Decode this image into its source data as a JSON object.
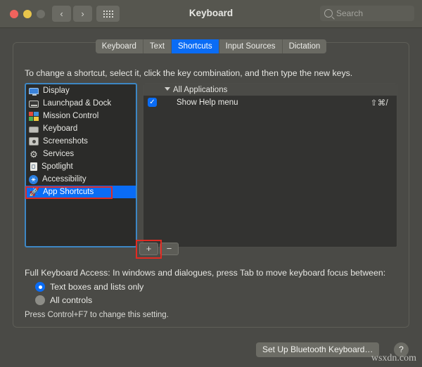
{
  "window": {
    "title": "Keyboard",
    "traffic_lights": [
      "close",
      "minimize",
      "zoom"
    ],
    "nav_back_icon": "chevron-left-icon",
    "nav_forward_icon": "chevron-right-icon",
    "apps_grid_icon": "grid-icon",
    "back_glyph": "‹",
    "forward_glyph": "›"
  },
  "search": {
    "placeholder": "Search",
    "value": "",
    "icon": "search-icon"
  },
  "tabs": [
    {
      "label": "Keyboard",
      "active": false
    },
    {
      "label": "Text",
      "active": false
    },
    {
      "label": "Shortcuts",
      "active": true
    },
    {
      "label": "Input Sources",
      "active": false
    },
    {
      "label": "Dictation",
      "active": false
    }
  ],
  "instructions": "To change a shortcut, select it, click the key combination, and then type the new keys.",
  "categories": [
    {
      "label": "Display",
      "icon": "display-icon",
      "selected": false
    },
    {
      "label": "Launchpad & Dock",
      "icon": "launchpad-icon",
      "selected": false
    },
    {
      "label": "Mission Control",
      "icon": "mission-control-icon",
      "selected": false
    },
    {
      "label": "Keyboard",
      "icon": "keyboard-icon",
      "selected": false
    },
    {
      "label": "Screenshots",
      "icon": "screenshots-icon",
      "selected": false
    },
    {
      "label": "Services",
      "icon": "services-gear-icon",
      "selected": false
    },
    {
      "label": "Spotlight",
      "icon": "spotlight-icon",
      "selected": false
    },
    {
      "label": "Accessibility",
      "icon": "accessibility-icon",
      "selected": false
    },
    {
      "label": "App Shortcuts",
      "icon": "app-shortcuts-icon",
      "selected": true
    }
  ],
  "shortcut_panel": {
    "group_label": "All Applications",
    "group_expanded": true,
    "disclosure_icon": "triangle-down-icon",
    "rows": [
      {
        "checked": true,
        "name": "Show Help menu",
        "keys": "⇧⌘/"
      }
    ]
  },
  "list_controls": {
    "add_label": "+",
    "remove_label": "−",
    "add_icon": "plus-icon",
    "remove_icon": "minus-icon"
  },
  "full_keyboard_access": {
    "description": "Full Keyboard Access: In windows and dialogues, press Tab to move keyboard focus between:",
    "options": [
      {
        "label": "Text boxes and lists only",
        "selected": true
      },
      {
        "label": "All controls",
        "selected": false
      }
    ],
    "hint": "Press Control+F7 to change this setting."
  },
  "footer": {
    "setup_button": "Set Up Bluetooth Keyboard…",
    "help_button": "?",
    "help_icon": "question-mark-icon"
  },
  "watermark": "wsxdn.com",
  "annotations": {
    "highlight_color": "#e22b22",
    "boxes": [
      "app-shortcuts-row",
      "add-button"
    ]
  },
  "colors": {
    "accent": "#0a6cf5",
    "window_bg": "#4a4a46",
    "titlebar_bg": "#56564f",
    "list_bg": "#2b2b29",
    "panel_bg": "#333331"
  }
}
